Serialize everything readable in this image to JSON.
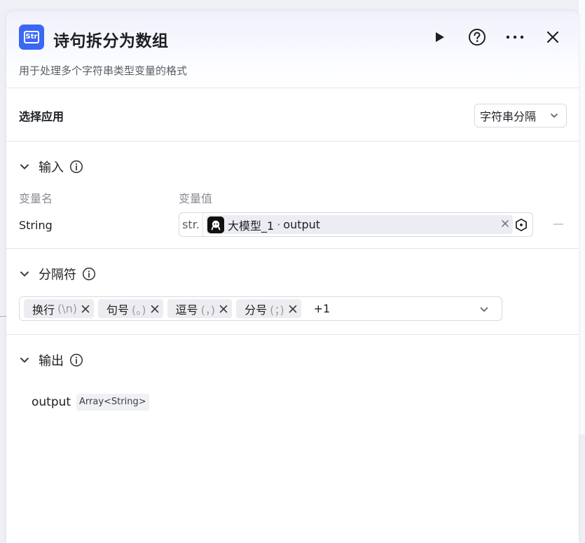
{
  "node": {
    "icon": "string-node-icon",
    "icon_text": "Str",
    "title": "诗句拆分为数组",
    "description": "用于处理多个字符串类型变量的格式",
    "accent": "#3b67f5"
  },
  "header_actions": [
    "play-icon",
    "help-icon",
    "more-icon",
    "close-icon"
  ],
  "app_section": {
    "label": "选择应用",
    "selected": "字符串分隔"
  },
  "input_section": {
    "title": "输入",
    "col_name": "变量名",
    "col_value": "变量值",
    "variable": {
      "name": "String",
      "type_tag": "str.",
      "ref_node": "大模型_1",
      "ref_sep": "·",
      "ref_output": "output"
    }
  },
  "separator_section": {
    "title": "分隔符",
    "tags": [
      {
        "label": "换行",
        "hint": "(\\n)"
      },
      {
        "label": "句号",
        "hint": "(。)"
      },
      {
        "label": "逗号",
        "hint": "(，)"
      },
      {
        "label": "分号",
        "hint": "(；)"
      }
    ],
    "more_count": "+1"
  },
  "output_section": {
    "title": "输出",
    "output": {
      "name": "output",
      "type": "Array<String>"
    }
  }
}
